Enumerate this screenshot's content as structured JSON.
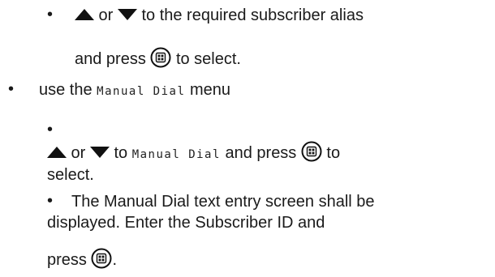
{
  "items": {
    "alias_step": {
      "or_text": " or ",
      "rest_text": " to the required subscriber alias",
      "and_press": "and press ",
      "to_select": " to select.",
      "up_icon": "up-arrow-icon",
      "down_icon": "down-arrow-icon",
      "menu_icon": "menu-ok-button-icon"
    },
    "manual_dial": {
      "prefix": "use the ",
      "menu_name": "Manual Dial",
      "suffix": " menu"
    },
    "manual_step": {
      "or_text": " or ",
      "to_text": " to ",
      "menu_name": "Manual Dial",
      "and_press": " and press ",
      "to_text_end": " to",
      "select_text": "select."
    },
    "entry_step": {
      "line1": "The Manual Dial text entry screen shall be",
      "line2": "displayed. Enter the Subscriber ID and",
      "line3_press": "press ",
      "line3_end": "."
    }
  }
}
